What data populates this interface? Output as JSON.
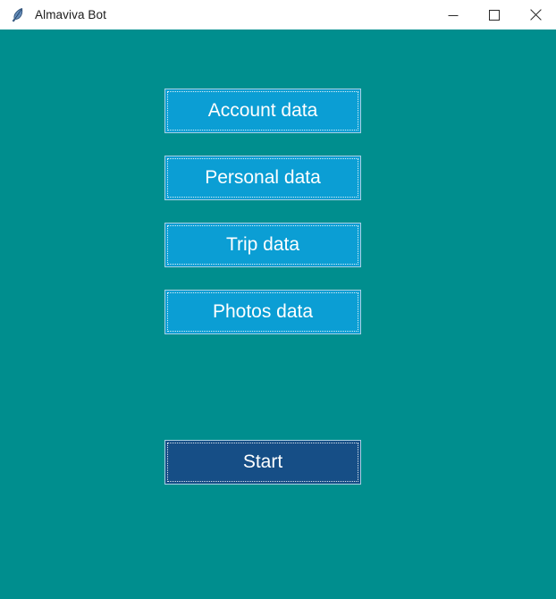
{
  "window": {
    "title": "Almaviva Bot",
    "icon": "feather-icon",
    "background_color": "#008e8e",
    "titlebar_color": "#ffffff",
    "controls": [
      {
        "name": "minimize",
        "glyph": "—",
        "label": "Minimize"
      },
      {
        "name": "maximize",
        "glyph": "□",
        "label": "Maximize"
      },
      {
        "name": "close",
        "glyph": "✕",
        "label": "Close"
      }
    ]
  },
  "main": {
    "buttons": [
      {
        "id": "account-data",
        "label": "Account data",
        "color": "#0b9ed4",
        "text_color": "#ffffff"
      },
      {
        "id": "personal-data",
        "label": "Personal data",
        "color": "#0b9ed4",
        "text_color": "#ffffff"
      },
      {
        "id": "trip-data",
        "label": "Trip data",
        "color": "#0b9ed4",
        "text_color": "#ffffff"
      },
      {
        "id": "photos-data",
        "label": "Photos data",
        "color": "#0b9ed4",
        "text_color": "#ffffff"
      }
    ],
    "start_button": {
      "id": "start",
      "label": "Start",
      "color": "#164e86",
      "text_color": "#ffffff"
    }
  }
}
